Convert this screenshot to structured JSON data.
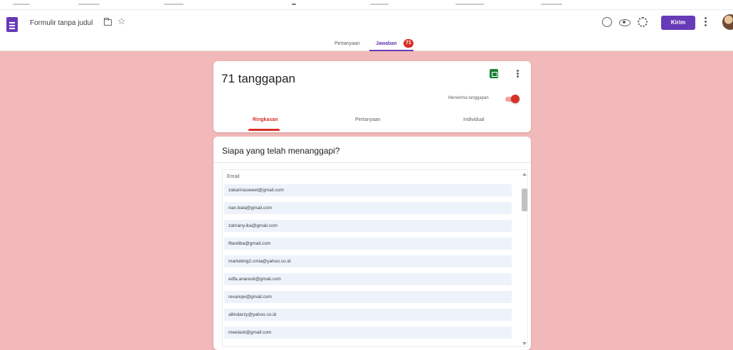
{
  "app": {
    "title": "Formulir tanpa judul",
    "send_label": "Kirim",
    "accent": "#673ab7",
    "page_background": "#f1b9b9"
  },
  "header_icons": [
    "folder-icon",
    "star-icon",
    "palette-icon",
    "eye-icon",
    "settings-icon",
    "more-vert-icon",
    "avatar"
  ],
  "tabs": {
    "questions": "Pertanyaan",
    "responses": "Jawaban",
    "responses_badge": "71"
  },
  "summary": {
    "count_text": "71 tanggapan",
    "accepting_label": "Menerima tanggapan",
    "accepting": true,
    "sub_tabs": {
      "summary": "Ringkasan",
      "question": "Pertanyaan",
      "individual": "Individual"
    }
  },
  "who": {
    "title": "Siapa yang telah menanggapi?",
    "column_header": "Email",
    "emails": [
      "zakarinasweet@gmail.com",
      "rian.bala@gmail.com",
      "zahrany.ika@gmail.com",
      "fitardiba@gmail.com",
      "marketing2.cmia@yahoo.co.id",
      "edfa.anaresti@gmail.com",
      "revanqw@gmail.com",
      "allindarzy@yahoo.co.id",
      "meelasti@gmail.com"
    ]
  }
}
